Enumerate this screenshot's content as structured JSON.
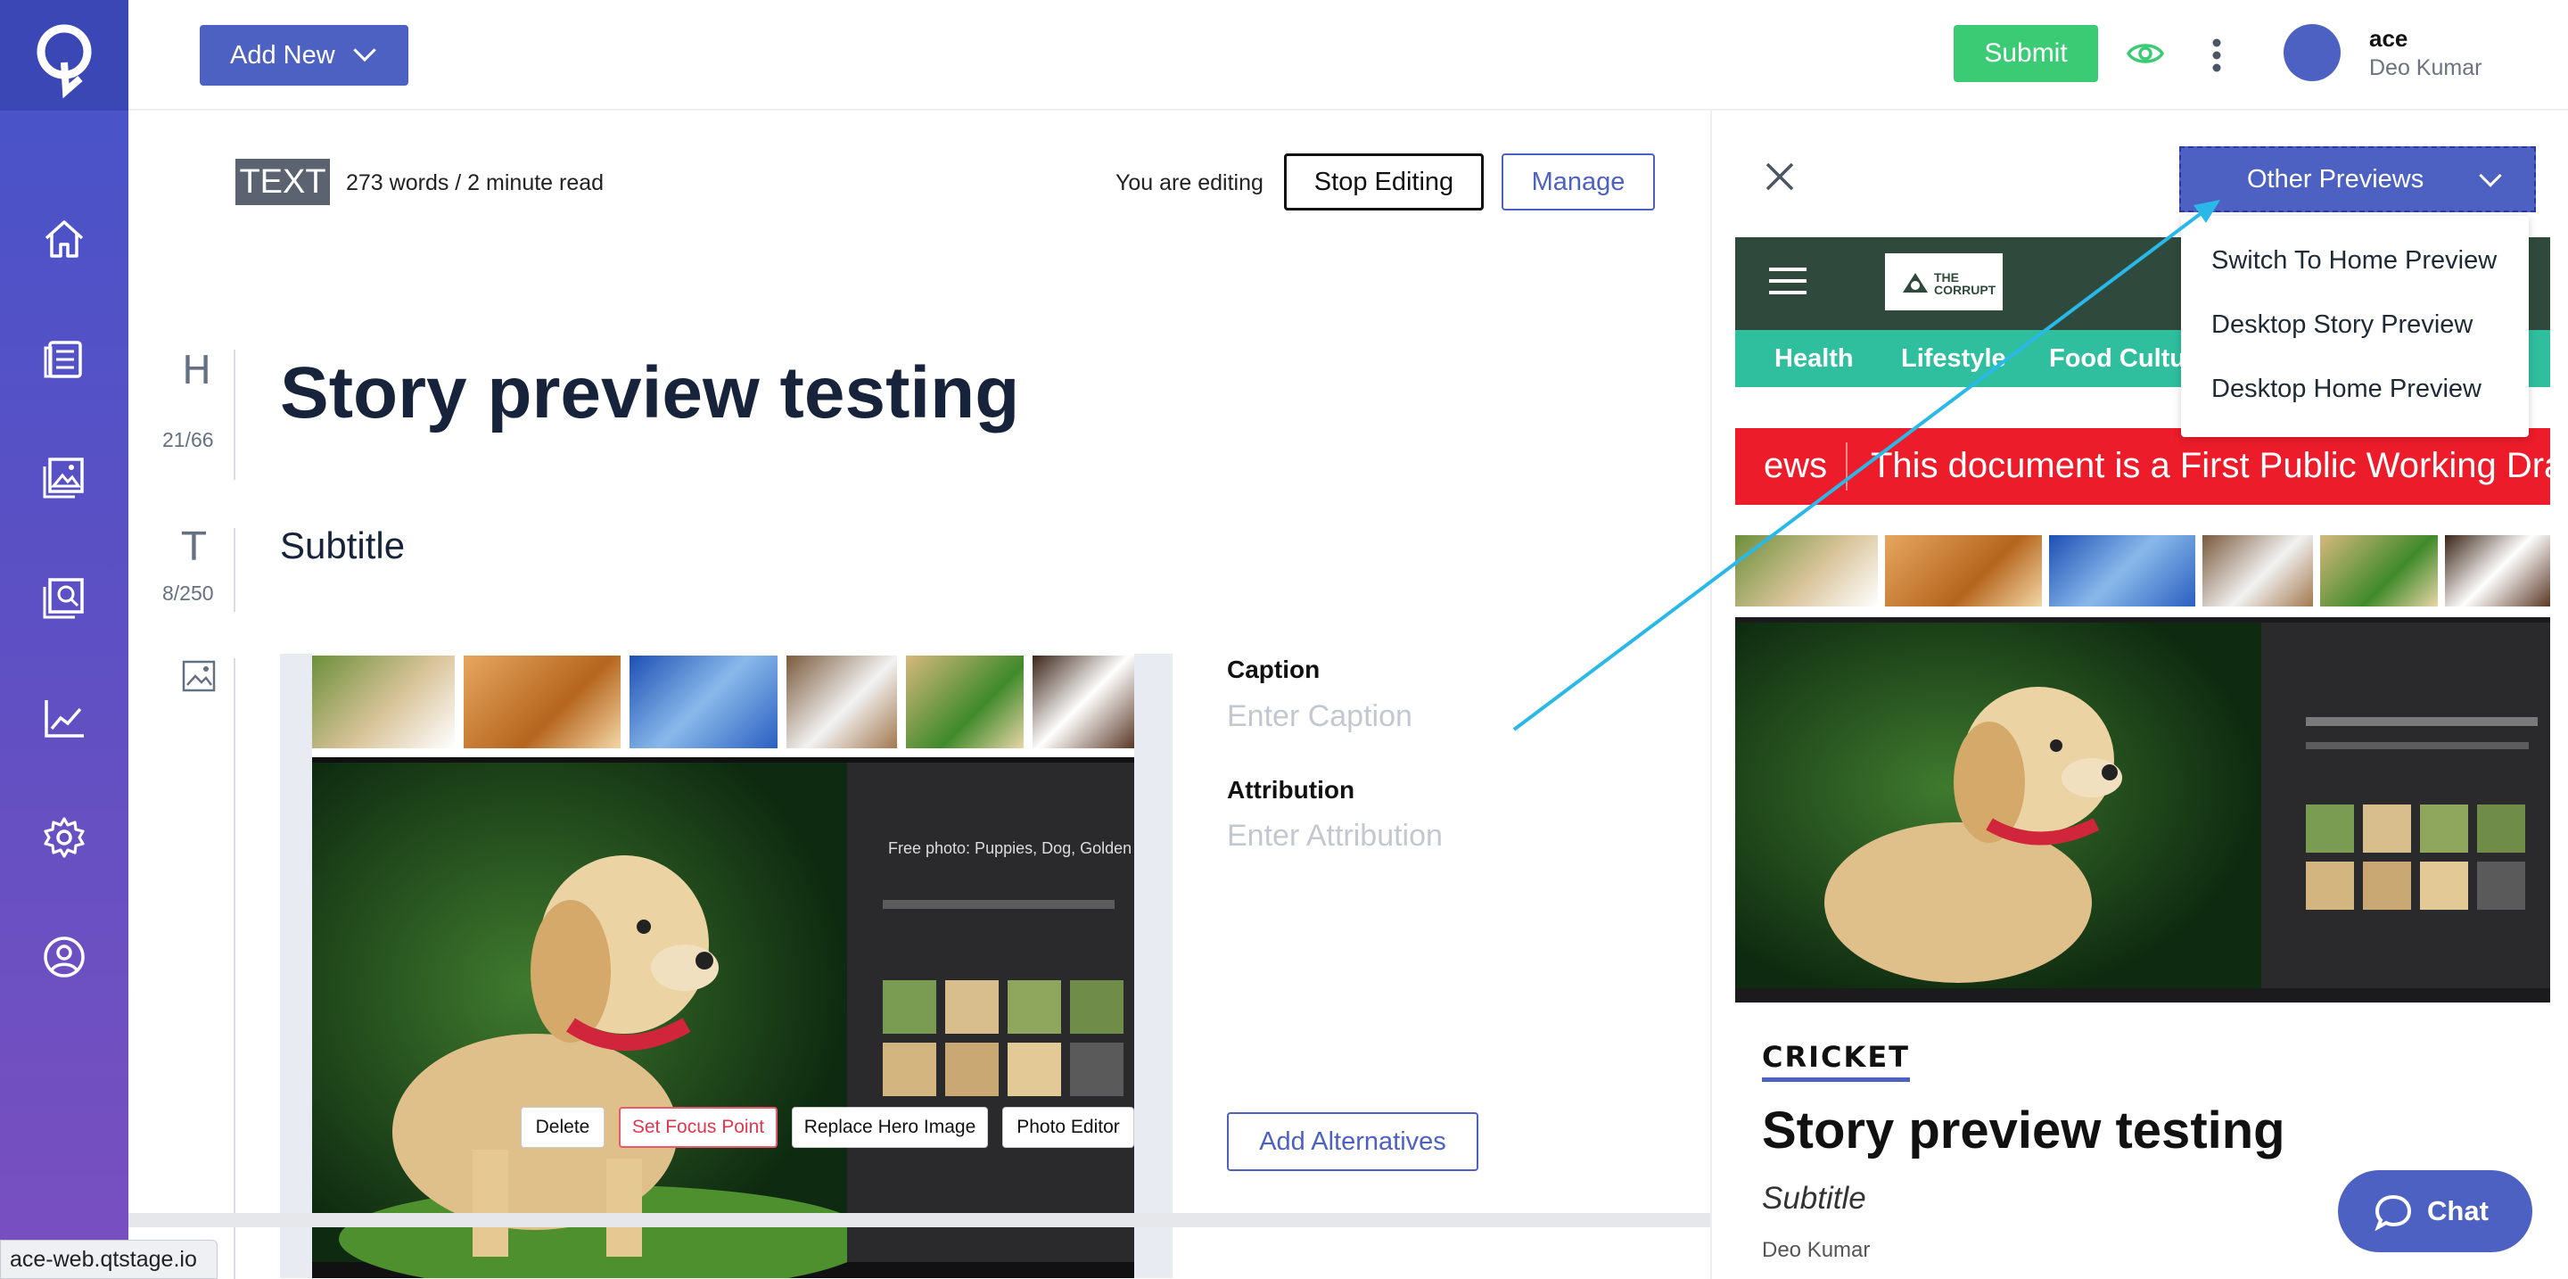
{
  "app": {
    "logo_letter": "Q",
    "status_url": "ace-web.qtstage.io",
    "sidebar": {
      "items": [
        {
          "icon": "home-icon"
        },
        {
          "icon": "stories-icon"
        },
        {
          "icon": "media-icon"
        },
        {
          "icon": "image-search-icon"
        },
        {
          "icon": "analytics-icon"
        },
        {
          "icon": "settings-icon"
        },
        {
          "icon": "profile-icon"
        }
      ]
    }
  },
  "topbar": {
    "add_new_label": "Add New",
    "submit_label": "Submit",
    "user": {
      "handle": "ace",
      "name": "Deo Kumar"
    }
  },
  "editor": {
    "badge": "TEXT",
    "word_count": "273 words / 2 minute read",
    "editing_label": "You are editing",
    "stop_editing_label": "Stop Editing",
    "manage_label": "Manage",
    "title_glyph": "H",
    "title_count": "21/66",
    "title": "Story preview testing",
    "subtitle_glyph": "T",
    "subtitle_count": "8/250",
    "subtitle": "Subtitle",
    "image_actions": {
      "delete": "Delete",
      "set_focus": "Set Focus Point",
      "replace": "Replace Hero Image",
      "photo_editor": "Photo Editor"
    },
    "caption_label": "Caption",
    "caption_placeholder": "Enter Caption",
    "attribution_label": "Attribution",
    "attribution_placeholder": "Enter Attribution",
    "add_alternatives_label": "Add Alternatives",
    "hero_image_text": "Free photo: Puppies, Dog, Golden Retr"
  },
  "preview": {
    "other_previews_label": "Other Previews",
    "dropdown": [
      "Switch To Home Preview",
      "Desktop Story Preview",
      "Desktop Home Preview"
    ],
    "site_logo": "THE CORRUPT",
    "nav": [
      "Health",
      "Lifestyle",
      "Food Cultu"
    ],
    "ticker_prefix": "ews",
    "ticker_text": "This document is a First Public Working Dra",
    "section": "CRICKET",
    "title": "Story preview testing",
    "subtitle": "Subtitle",
    "author": "Deo Kumar"
  },
  "chat": {
    "label": "Chat"
  },
  "colors": {
    "accent": "#4d61c3",
    "submit": "#3ccb75",
    "site_header": "#2f4a3c",
    "site_nav": "#2fbf9f",
    "ticker": "#ec1c2a",
    "arrow": "#29b8e8"
  }
}
